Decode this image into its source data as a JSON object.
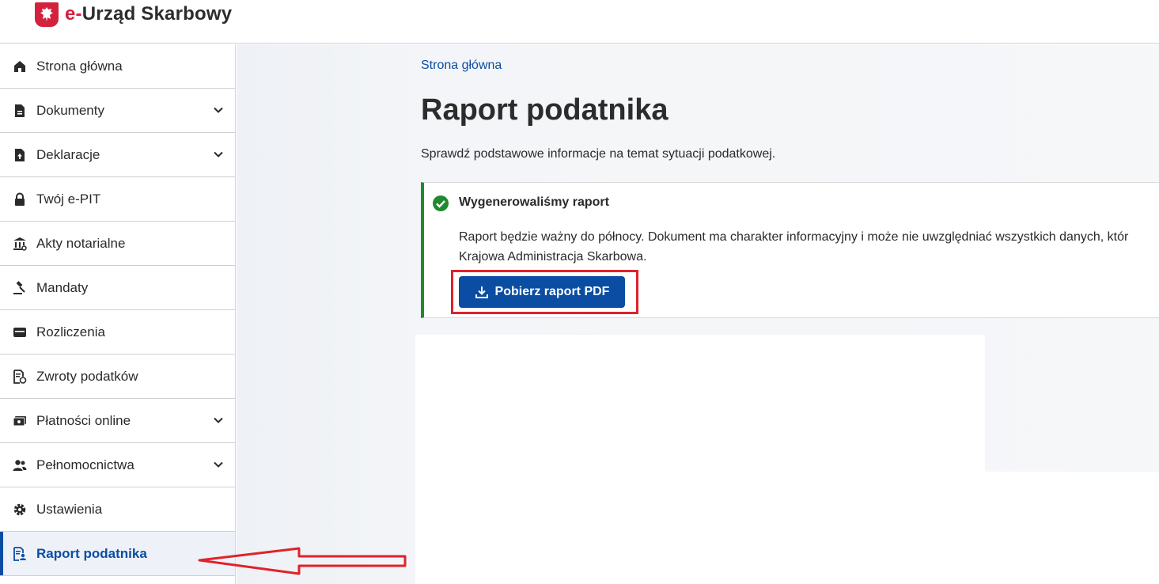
{
  "header": {
    "logo_prefix": "e-",
    "logo_rest": "Urząd Skarbowy"
  },
  "sidebar": {
    "items": [
      {
        "label": "Strona główna",
        "icon": "home-icon",
        "chevron": false,
        "active": false
      },
      {
        "label": "Dokumenty",
        "icon": "document-icon",
        "chevron": true,
        "active": false
      },
      {
        "label": "Deklaracje",
        "icon": "upload-file-icon",
        "chevron": true,
        "active": false
      },
      {
        "label": "Twój e-PIT",
        "icon": "lock-icon",
        "chevron": false,
        "active": false
      },
      {
        "label": "Akty notarialne",
        "icon": "bank-icon",
        "chevron": false,
        "active": false
      },
      {
        "label": "Mandaty",
        "icon": "gavel-icon",
        "chevron": false,
        "active": false
      },
      {
        "label": "Rozliczenia",
        "icon": "wallet-icon",
        "chevron": false,
        "active": false
      },
      {
        "label": "Zwroty podatków",
        "icon": "refund-document-icon",
        "chevron": false,
        "active": false
      },
      {
        "label": "Płatności online",
        "icon": "payments-icon",
        "chevron": true,
        "active": false
      },
      {
        "label": "Pełnomocnictwa",
        "icon": "users-icon",
        "chevron": true,
        "active": false
      },
      {
        "label": "Ustawienia",
        "icon": "gear-icon",
        "chevron": false,
        "active": false
      },
      {
        "label": "Raport podatnika",
        "icon": "report-icon",
        "chevron": false,
        "active": true
      }
    ]
  },
  "main": {
    "breadcrumb": "Strona główna",
    "title": "Raport podatnika",
    "subtitle": "Sprawdź podstawowe informacje na temat sytuacji podatkowej.",
    "alert": {
      "title": "Wygenerowaliśmy raport",
      "line1": "Raport będzie ważny do północy. Dokument ma charakter informacyjny i może nie uwzględniać wszystkich danych, któr",
      "line2": "Krajowa Administracja Skarbowa.",
      "button_label": "Pobierz raport PDF"
    }
  },
  "colors": {
    "accent": "#0b4da2",
    "brand_red": "#d4213d",
    "success": "#1f8a2e",
    "annotation": "#e0222b"
  }
}
